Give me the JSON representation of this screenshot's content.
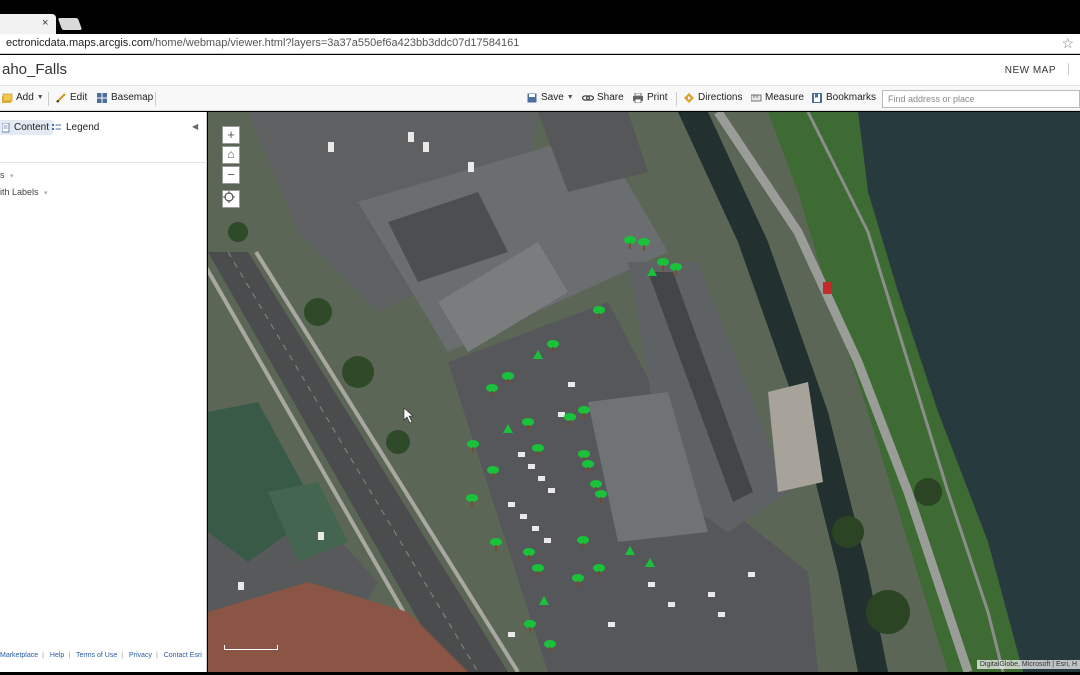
{
  "browser": {
    "tab_close": "×",
    "url_host": "ectronicdata.maps.arcgis.com",
    "url_path": "/home/webmap/viewer.html?layers=3a37a550ef6a423bb3ddc07d17584161",
    "bookmark_star": "☆"
  },
  "header": {
    "title": "aho_Falls",
    "new_map": "NEW MAP"
  },
  "toolbar": {
    "add": "Add",
    "edit": "Edit",
    "basemap": "Basemap",
    "save": "Save",
    "share": "Share",
    "print": "Print",
    "directions": "Directions",
    "measure": "Measure",
    "bookmarks": "Bookmarks",
    "search_placeholder": "Find address or place"
  },
  "panel": {
    "tabs": [
      "Content",
      "Legend"
    ],
    "layers": [
      "s",
      "ith Labels"
    ],
    "footer_links": [
      "Marketplace",
      "Help",
      "Terms of Use",
      "Privacy",
      "Contact Esri"
    ]
  },
  "map": {
    "zoom_in": "+",
    "home": "⌂",
    "zoom_out": "−",
    "attribution": "DigitalGlobe, Microsoft | Esri, H",
    "marker_color": "#19c23a",
    "water_color": "#273a3e",
    "roof_color": "#6b6e70"
  }
}
